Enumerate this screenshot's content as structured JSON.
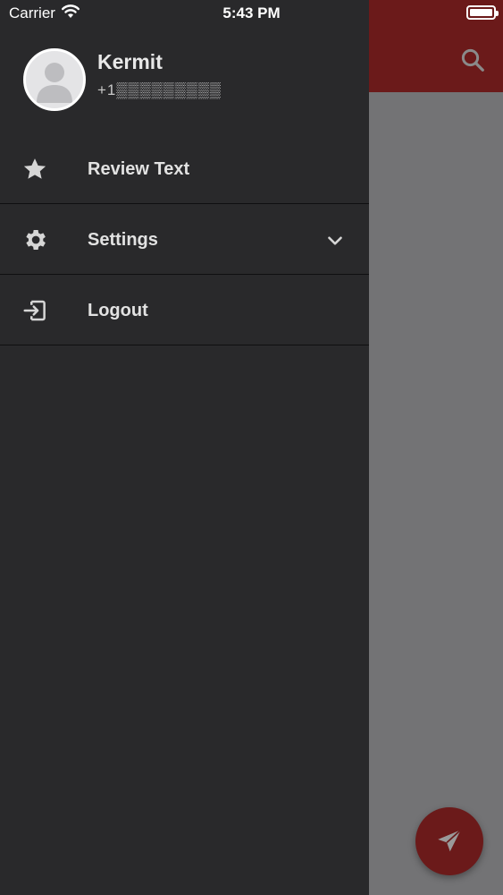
{
  "status_bar": {
    "carrier": "Carrier",
    "time": "5:43 PM"
  },
  "drawer": {
    "user": {
      "name": "Kermit",
      "phone": "+1▒▒▒▒▒▒▒▒▒"
    },
    "items": [
      {
        "label": "Review Text",
        "icon": "star-icon"
      },
      {
        "label": "Settings",
        "icon": "gear-icon",
        "expandable": true
      },
      {
        "label": "Logout",
        "icon": "logout-icon"
      }
    ]
  },
  "colors": {
    "drawer_bg": "#29292b",
    "accent": "#8b1a1a",
    "scrim": "#737375"
  }
}
